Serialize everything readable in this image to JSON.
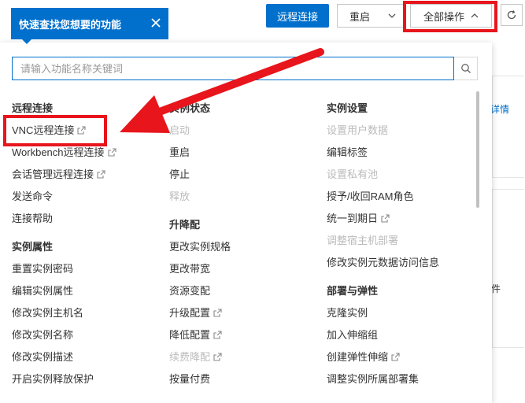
{
  "toolbar": {
    "remote_connect_label": "远程连接",
    "restart_label": "重启",
    "all_actions_label": "全部操作"
  },
  "tooltip": {
    "text": "快速查找您想要的功能"
  },
  "search": {
    "placeholder": "请输入功能名称关键词"
  },
  "background": {
    "right_link": "详情",
    "right_char": "件"
  },
  "columns": [
    {
      "sections": [
        {
          "title": "远程连接",
          "items": [
            {
              "label": "VNC远程连接",
              "external": true,
              "disabled": false
            },
            {
              "label": "Workbench远程连接",
              "external": true,
              "disabled": false
            },
            {
              "label": "会话管理远程连接",
              "external": true,
              "disabled": false
            },
            {
              "label": "发送命令",
              "external": false,
              "disabled": false
            },
            {
              "label": "连接帮助",
              "external": false,
              "disabled": false
            }
          ]
        },
        {
          "title": "实例属性",
          "items": [
            {
              "label": "重置实例密码",
              "external": false,
              "disabled": false
            },
            {
              "label": "编辑实例属性",
              "external": false,
              "disabled": false
            },
            {
              "label": "修改实例主机名",
              "external": false,
              "disabled": false
            },
            {
              "label": "修改实例名称",
              "external": false,
              "disabled": false
            },
            {
              "label": "修改实例描述",
              "external": false,
              "disabled": false
            },
            {
              "label": "开启实例释放保护",
              "external": false,
              "disabled": false
            }
          ]
        }
      ]
    },
    {
      "sections": [
        {
          "title": "实例状态",
          "items": [
            {
              "label": "启动",
              "external": false,
              "disabled": true
            },
            {
              "label": "重启",
              "external": false,
              "disabled": false
            },
            {
              "label": "停止",
              "external": false,
              "disabled": false
            },
            {
              "label": "释放",
              "external": false,
              "disabled": true
            }
          ]
        },
        {
          "title": "升降配",
          "items": [
            {
              "label": "更改实例规格",
              "external": false,
              "disabled": false
            },
            {
              "label": "更改带宽",
              "external": false,
              "disabled": false
            },
            {
              "label": "资源变配",
              "external": false,
              "disabled": false
            },
            {
              "label": "升级配置",
              "external": true,
              "disabled": false
            },
            {
              "label": "降低配置",
              "external": true,
              "disabled": false
            },
            {
              "label": "续费降配",
              "external": true,
              "disabled": true
            },
            {
              "label": "按量付费",
              "external": false,
              "disabled": false
            }
          ]
        }
      ]
    },
    {
      "sections": [
        {
          "title": "实例设置",
          "items": [
            {
              "label": "设置用户数据",
              "external": false,
              "disabled": true
            },
            {
              "label": "编辑标签",
              "external": false,
              "disabled": false
            },
            {
              "label": "设置私有池",
              "external": false,
              "disabled": true
            },
            {
              "label": "授予/收回RAM角色",
              "external": false,
              "disabled": false
            },
            {
              "label": "统一到期日",
              "external": true,
              "disabled": false
            },
            {
              "label": "调整宿主机部署",
              "external": false,
              "disabled": true
            },
            {
              "label": "修改实例元数据访问信息",
              "external": false,
              "disabled": false
            }
          ]
        },
        {
          "title": "部署与弹性",
          "items": [
            {
              "label": "克隆实例",
              "external": false,
              "disabled": false
            },
            {
              "label": "加入伸缩组",
              "external": false,
              "disabled": false
            },
            {
              "label": "创建弹性伸缩",
              "external": true,
              "disabled": false
            },
            {
              "label": "调整实例所属部署集",
              "external": false,
              "disabled": false
            }
          ]
        }
      ]
    }
  ],
  "colors": {
    "accent": "#0070cc",
    "annotation": "#e8151c",
    "disabled": "#bbbbbb"
  },
  "icons": [
    "search-icon",
    "close-icon",
    "chevron-down-icon",
    "chevron-up-icon",
    "refresh-icon",
    "external-link-icon"
  ]
}
